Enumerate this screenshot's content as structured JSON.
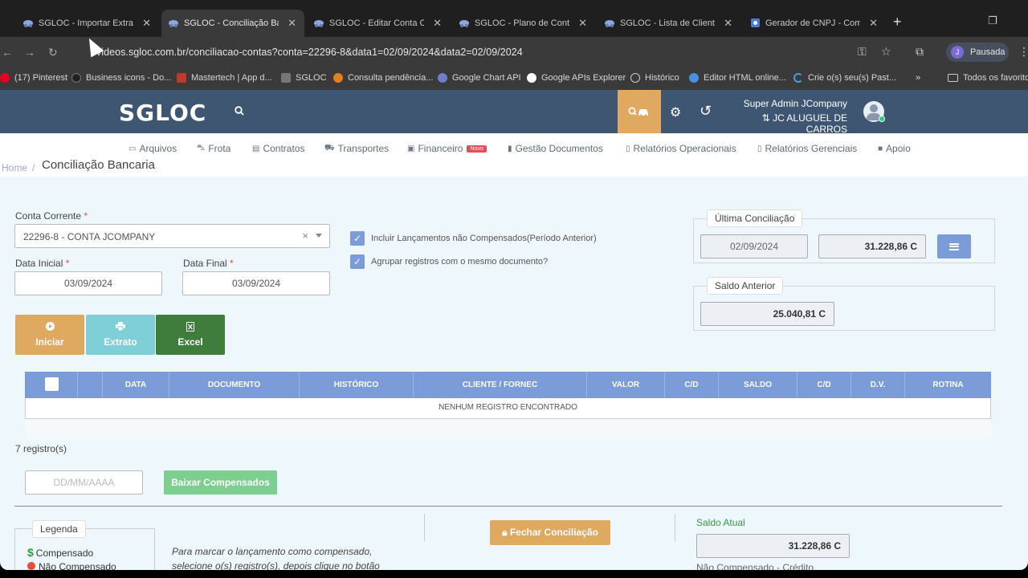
{
  "browser": {
    "tabs": [
      {
        "title": "SGLOC - Importar Extrato B",
        "active": false
      },
      {
        "title": "SGLOC - Conciliação Banca",
        "active": true
      },
      {
        "title": "SGLOC - Editar Conta Corr",
        "active": false
      },
      {
        "title": "SGLOC - Plano de Contas",
        "active": false
      },
      {
        "title": "SGLOC - Lista de Clientes",
        "active": false
      },
      {
        "title": "Gerador de CNPJ - Como C",
        "active": false
      }
    ],
    "url": "videos.sgloc.com.br/conciliacao-contas?conta=22296-8&data1=02/09/2024&data2=02/09/2024",
    "profile_initial": "J",
    "profile_status": "Pausada",
    "bookmarks": [
      "(17) Pinterest",
      "Business icons - Do...",
      "Mastertech | App d...",
      "SGLOC",
      "Consulta pendência...",
      "Google Chart API",
      "Google APIs Explorer",
      "Histórico",
      "Editor HTML online...",
      "Crie o(s) seu(s) Past..."
    ],
    "bookmarks_overflow": "»",
    "all_bookmarks": "Todos os favoritos"
  },
  "app": {
    "logo": "SGLOC",
    "user_name": "Super Admin JCompany",
    "company": "JC ALUGUEL DE CARROS",
    "company_icon": "⇅",
    "menu": [
      {
        "label": "Arquivos",
        "icon": "folder-icon"
      },
      {
        "label": "Frota",
        "icon": "car-icon"
      },
      {
        "label": "Contratos",
        "icon": "document-icon"
      },
      {
        "label": "Transportes",
        "icon": "truck-icon"
      },
      {
        "label": "Financeiro",
        "icon": "money-icon",
        "badge": "Novo"
      },
      {
        "label": "Gestão Documentos",
        "icon": "book-icon"
      },
      {
        "label": "Relatórios Operacionais",
        "icon": "report-icon"
      },
      {
        "label": "Relatórios Gerenciais",
        "icon": "report-icon"
      },
      {
        "label": "Apoio",
        "icon": "support-icon"
      }
    ],
    "breadcrumb": {
      "home": "Home",
      "sep": "/",
      "current": "Conciliação Bancaria"
    }
  },
  "form": {
    "conta_label": "Conta Corrente",
    "required_mark": "*",
    "conta_value": "22296-8 - CONTA JCOMPANY",
    "clear_glyph": "×",
    "data_inicial_label": "Data Inicial",
    "data_inicial_value": "03/09/2024",
    "data_final_label": "Data Final",
    "data_final_value": "03/09/2024",
    "check1": "Incluir Lançamentos não Compensados(Período Anterior)",
    "check2": "Agrupar registros com o mesmo documento?",
    "check_glyph": "✓"
  },
  "ultima": {
    "title": "Última Conciliação",
    "date": "02/09/2024",
    "value": "31.228,86 C"
  },
  "saldo_anterior": {
    "title": "Saldo Anterior",
    "value": "25.040,81 C"
  },
  "actions": {
    "iniciar": "Iniciar",
    "extrato": "Extrato",
    "excel": "Excel"
  },
  "table": {
    "columns": [
      "",
      "",
      "DATA",
      "DOCUMENTO",
      "HISTÓRICO",
      "CLIENTE / FORNEC",
      "VALOR",
      "C/D",
      "SALDO",
      "C/D",
      "D.V.",
      "ROTINA"
    ],
    "empty": "NENHUM REGISTRO ENCONTRADO"
  },
  "footer": {
    "count": "7 registro(s)",
    "date_placeholder": "DD/MM/AAAA",
    "baixar": "Baixar Compensados",
    "legend_title": "Legenda",
    "leg_compensado": "Compensado",
    "leg_dollar": "$",
    "leg_nao": "Não Compensado",
    "help_text": "Para marcar o lançamento como compensado, selecione o(s) registro(s), depois clique no botão",
    "fechar": "Fechar Conciliação",
    "saldo_atual_label": "Saldo Atual",
    "saldo_atual_value": "31.228,86 C",
    "nao_comp_credito": "Não Compensado - Crédito"
  },
  "colors": {
    "accent_blue": "#7b9cd9",
    "header_blue": "#3f5673",
    "orange": "#e0a960",
    "green": "#3e7d3c",
    "teal": "#7fcfd9",
    "light_green": "#7ccf8f"
  }
}
